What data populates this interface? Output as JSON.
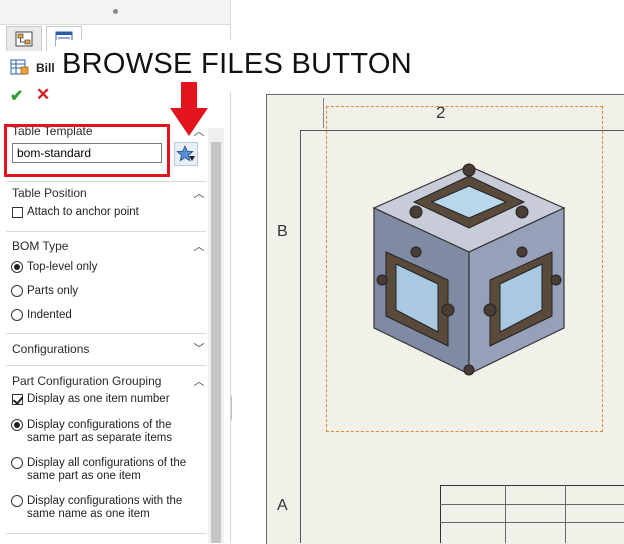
{
  "property_manager": {
    "title": "Bill"
  },
  "annotation": {
    "banner": "BROWSE FILES BUTTON"
  },
  "sections": {
    "table_template": {
      "title": "Table Template",
      "value": "bom-standard"
    },
    "table_position": {
      "title": "Table Position",
      "attach_label": "Attach to anchor point"
    },
    "bom_type": {
      "title": "BOM Type",
      "options": [
        "Top-level only",
        "Parts only",
        "Indented"
      ]
    },
    "configurations": {
      "title": "Configurations"
    },
    "part_config_grouping": {
      "title": "Part Configuration Grouping",
      "display_one_item": "Display as one item number",
      "opt1_line1": "Display configurations of the",
      "opt1_line2": "same part as separate items",
      "opt2_line1": "Display all configurations of the",
      "opt2_line2": "same part as one item",
      "opt3_line1": "Display configurations with the",
      "opt3_line2": "same name as one item"
    }
  },
  "drawing": {
    "zone_top": "2",
    "zone_b": "B",
    "zone_a": "A"
  },
  "colors": {
    "accept": "#2e9c2e",
    "cancel": "#d02020",
    "highlight": "#e2141e",
    "view_boundary": "#e08a3a"
  },
  "icons": [
    "property-tab-icon",
    "bom-table-icon",
    "check-icon",
    "close-icon",
    "browse-star-icon",
    "chevron-up-icon",
    "chevron-down-icon",
    "down-arrow-icon"
  ]
}
